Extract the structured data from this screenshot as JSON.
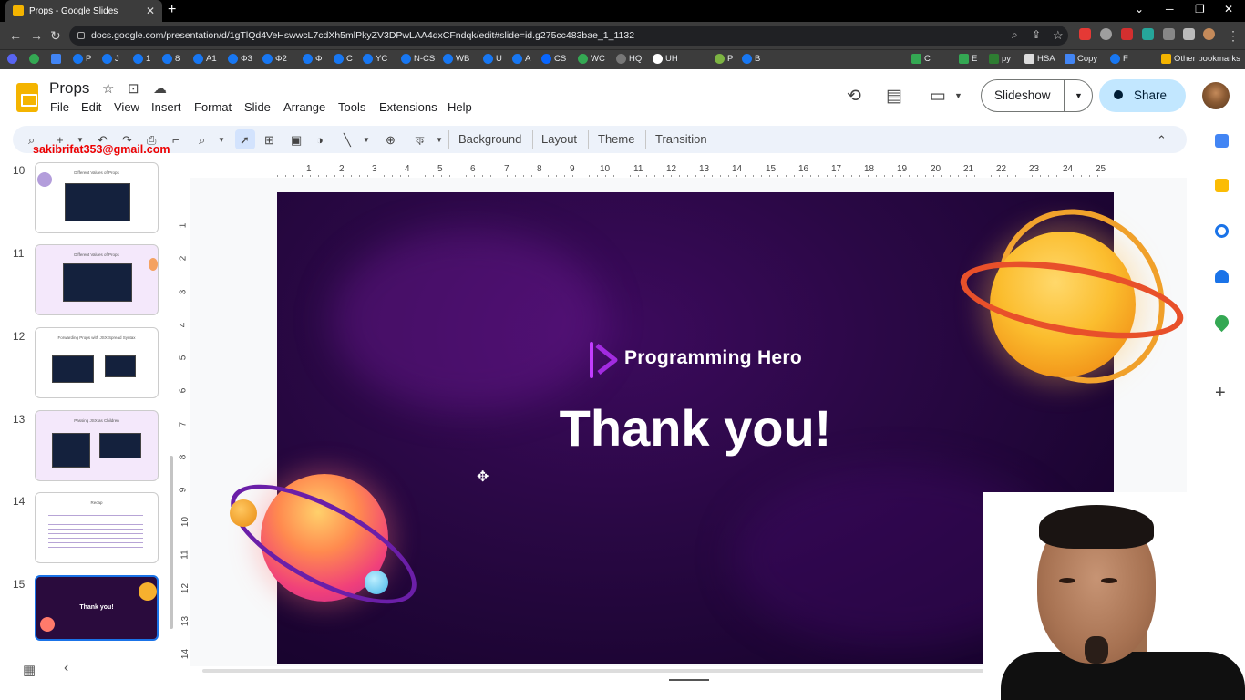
{
  "browser": {
    "tab_title": "Props - Google Slides",
    "url": "docs.google.com/presentation/d/1gTlQd4VeHswwcL7cdXh5mlPkyZV3DPwLAA4dxCFndqk/edit#slide=id.g275cc483bae_1_1132",
    "bookmarks": [
      "P",
      "J",
      "1",
      "8",
      "A1",
      "Φ3",
      "Φ2",
      "Φ",
      "C",
      "YC",
      "N-CS",
      "WB",
      "U",
      "A",
      "CS",
      "WC",
      "HQ",
      "UH",
      "P",
      "B",
      "C",
      "E",
      "py",
      "HSA",
      "Copy",
      "F"
    ],
    "other_bookmarks": "Other bookmarks"
  },
  "app": {
    "doc_title": "Props",
    "menu": [
      "File",
      "Edit",
      "View",
      "Insert",
      "Format",
      "Slide",
      "Arrange",
      "Tools",
      "Extensions",
      "Help"
    ],
    "slideshow_label": "Slideshow",
    "share_label": "Share"
  },
  "toolbar": {
    "background": "Background",
    "layout": "Layout",
    "theme": "Theme",
    "transition": "Transition"
  },
  "overlay_email": "sakibrifat353@gmail.com",
  "filmstrip": {
    "slides": [
      {
        "num": "10",
        "title": "Different Values of Props"
      },
      {
        "num": "11",
        "title": "Different Values of Props"
      },
      {
        "num": "12",
        "title": "Forwarding Props with JSX Spread Syntax"
      },
      {
        "num": "13",
        "title": "Passing JSX as Children"
      },
      {
        "num": "14",
        "title": "Recap"
      },
      {
        "num": "15",
        "title": "Thank you!"
      }
    ]
  },
  "ruler": {
    "h": [
      "1",
      "2",
      "3",
      "4",
      "5",
      "6",
      "7",
      "8",
      "9",
      "10",
      "11",
      "12",
      "13",
      "14",
      "15",
      "16",
      "17",
      "18",
      "19",
      "20",
      "21",
      "22",
      "23",
      "24",
      "25"
    ],
    "v": [
      "1",
      "2",
      "3",
      "4",
      "5",
      "6",
      "7",
      "8",
      "9",
      "10",
      "11",
      "12",
      "13",
      "14"
    ]
  },
  "slide": {
    "brand": "Programming Hero",
    "headline": "Thank you!"
  }
}
